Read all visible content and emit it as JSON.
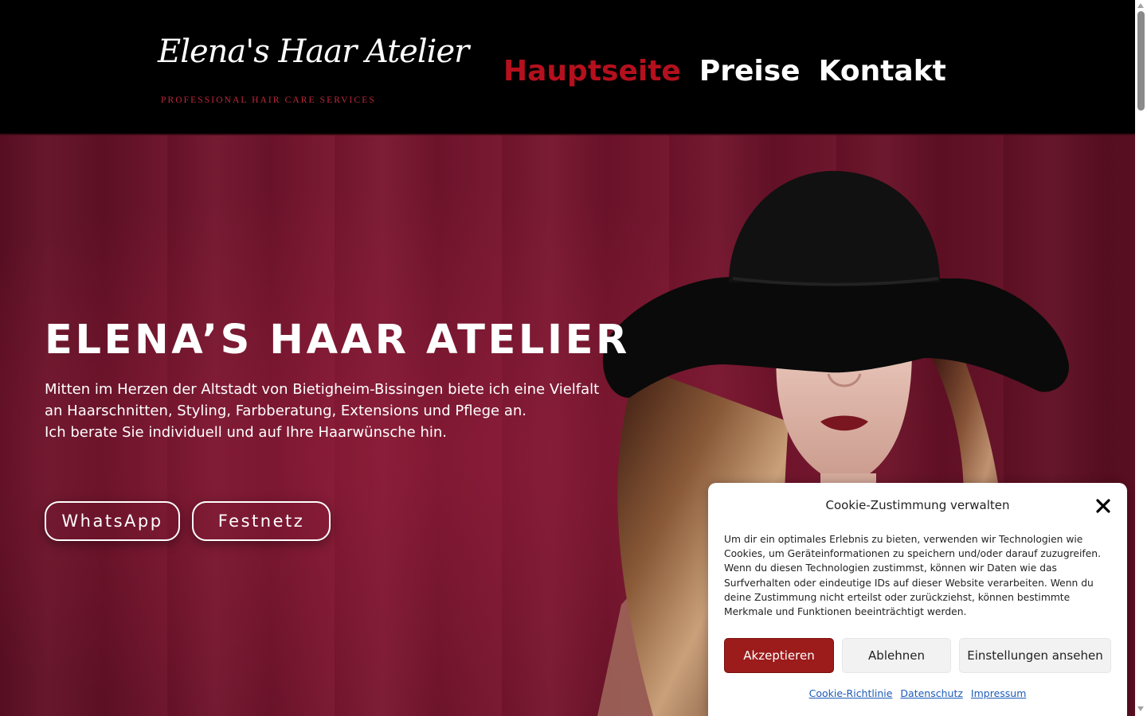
{
  "header": {
    "logo": {
      "script_text": "Elena's Haar Atelier",
      "tagline": "PROFESSIONAL HAIR CARE SERVICES"
    },
    "nav": [
      {
        "label": "Hauptseite",
        "active": true
      },
      {
        "label": "Preise",
        "active": false
      },
      {
        "label": "Kontakt",
        "active": false
      }
    ]
  },
  "hero": {
    "title": "ELENA’S HAAR ATELIER",
    "text_lines": [
      "Mitten im Herzen der Altstadt von Bietigheim-Bissingen biete ich eine Vielfalt",
      "an Haarschnitten, Styling, Farbberatung, Extensions und Pflege an.",
      "Ich berate Sie individuell und auf Ihre Haarwünsche hin."
    ],
    "buttons": {
      "whatsapp": "WhatsApp",
      "landline": "Festnetz"
    }
  },
  "cookie_banner": {
    "title": "Cookie-Zustimmung verwalten",
    "body": "Um dir ein optimales Erlebnis zu bieten, verwenden wir Technologien wie Cookies, um Geräteinformationen zu speichern und/oder darauf zuzugreifen. Wenn du diesen Technologien zustimmst, können wir Daten wie das Surfverhalten oder eindeutige IDs auf dieser Website verarbeiten. Wenn du deine Zustimmung nicht erteilst oder zurückziehst, können bestimmte Merkmale und Funktionen beeinträchtigt werden.",
    "accept_label": "Akzeptieren",
    "deny_label": "Ablehnen",
    "preferences_label": "Einstellungen ansehen",
    "links": {
      "cookie_policy": "Cookie-Richtlinie",
      "privacy": "Datenschutz",
      "imprint": "Impressum"
    }
  },
  "colors": {
    "header_bg": "#000000",
    "nav_active": "#b5101d",
    "hero_bg": "#74142d",
    "accept_button": "#9c1b1b",
    "link": "#1e5bb8",
    "logo_tagline": "#c0283c"
  },
  "icons": {
    "close": "close-icon"
  }
}
